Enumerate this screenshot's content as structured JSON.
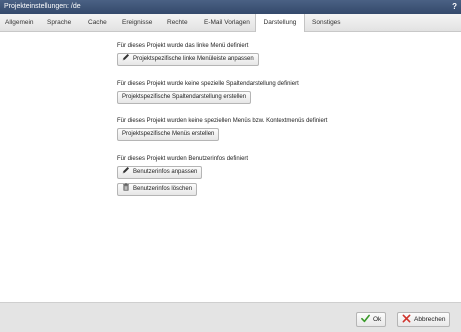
{
  "window": {
    "title": "Projekteinstellungen: /de",
    "help_label": "?"
  },
  "tabs": [
    {
      "label": "Allgemein",
      "active": false
    },
    {
      "label": "Sprache",
      "active": false
    },
    {
      "label": "Cache",
      "active": false
    },
    {
      "label": "Ereignisse",
      "active": false
    },
    {
      "label": "Rechte",
      "active": false
    },
    {
      "label": "E-Mail Vorlagen",
      "active": false
    },
    {
      "label": "Darstellung",
      "active": true
    },
    {
      "label": "Sonstiges",
      "active": false
    }
  ],
  "sections": [
    {
      "description": "Für dieses Projekt wurde das linke Menü definiert",
      "buttons": [
        {
          "label": "Projektspezifische linke Menüleiste anpassen",
          "icon": "pencil-icon"
        }
      ]
    },
    {
      "description": "Für dieses Projekt wurde keine spezielle Spaltendarstellung definiert",
      "buttons": [
        {
          "label": "Projektspezifische Spaltendarstellung erstellen",
          "icon": ""
        }
      ]
    },
    {
      "description": "Für dieses Projekt wurden keine speziellen Menüs bzw. Kontextmenüs definiert",
      "buttons": [
        {
          "label": "Projektspezifische Menüs erstellen",
          "icon": ""
        }
      ]
    },
    {
      "description": "Für dieses Projekt wurden Benutzerinfos definiert",
      "buttons": [
        {
          "label": "Benutzerinfos anpassen",
          "icon": "pencil-icon"
        },
        {
          "label": "Benutzerinfos löschen",
          "icon": "trash-icon"
        }
      ]
    }
  ],
  "footer": {
    "ok_label": "Ok",
    "cancel_label": "Abbrechen"
  },
  "colors": {
    "titlebar": "#3f5477",
    "ok_check": "#3a9a2a",
    "cancel_x": "#d0342c"
  }
}
